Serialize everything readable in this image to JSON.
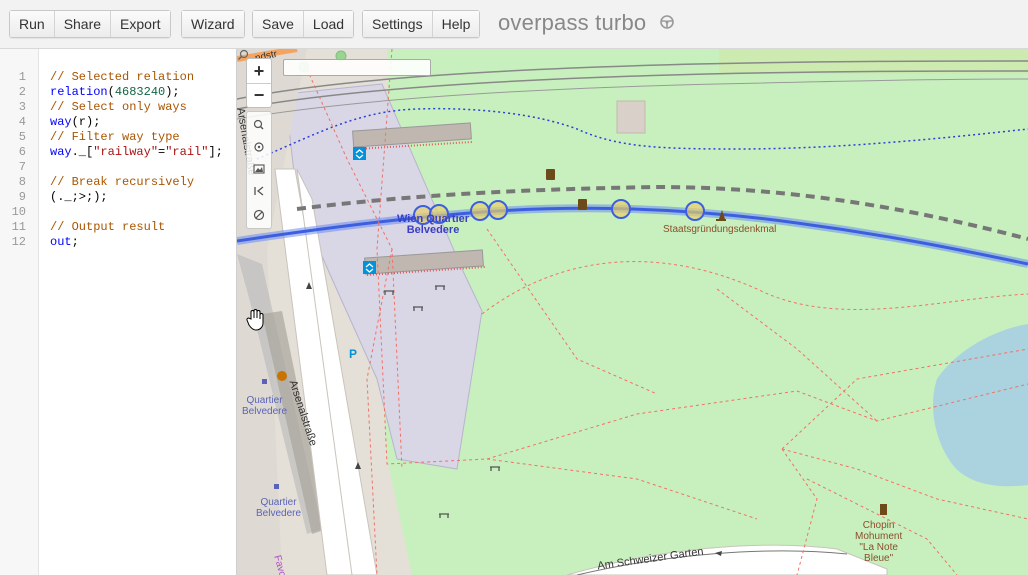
{
  "toolbar": {
    "run": "Run",
    "share": "Share",
    "export": "Export",
    "wizard": "Wizard",
    "save": "Save",
    "load": "Load",
    "settings": "Settings",
    "help": "Help"
  },
  "brand": {
    "title": "overpass turbo"
  },
  "editor": {
    "line_numbers": [
      "1",
      "2",
      "3",
      "4",
      "5",
      "6",
      "7",
      "8",
      "9",
      "10",
      "11",
      "12"
    ],
    "lines": {
      "l1": "// Selected relation",
      "l2_fn": "relation",
      "l2_open": "(",
      "l2_num": "4683240",
      "l2_close": ");",
      "l3": "// Select only ways",
      "l4_fn": "way",
      "l4_rest": "(r);",
      "l5": "// Filter way type",
      "l6_fn": "way",
      "l6_a": "._[",
      "l6_k": "\"railway\"",
      "l6_eq": "=",
      "l6_v": "\"rail\"",
      "l6_end": "];",
      "l8": "// Break recursively",
      "l9": "(._;>;);",
      "l11": "// Output result",
      "l12_fn": "out",
      "l12_end": ";"
    }
  },
  "map": {
    "search_placeholder": "",
    "zoom_in": "+",
    "zoom_out": "−",
    "labels": {
      "station": "Wien Quartier\nBelvedere",
      "station_l1": "Wien Quartier",
      "station_l2": "Belvedere",
      "monument": "Staatsgründungsdenkmal",
      "street_arsenal": "Arsenalstraße",
      "street_schweizer": "Am Schweizer Garten",
      "street_top_partial": "ndstr",
      "street_left_partial": "Arsenalstraße",
      "qb1_l1": "Quartier",
      "qb1_l2": "Belvedere",
      "qb2_l1": "Quartier",
      "qb2_l2": "Belvedere",
      "chopin_l1": "Chopin",
      "chopin_l2": "Mohument",
      "chopin_l3": "\"La Note",
      "chopin_l4": "Bleue\"",
      "favoriten_partial": "Favo"
    },
    "colors": {
      "park": "#c8f0be",
      "road": "#ffffff",
      "landuse": "#e2ded7",
      "highlight_rail": "#3c5fe0",
      "water": "#aad3df"
    }
  }
}
